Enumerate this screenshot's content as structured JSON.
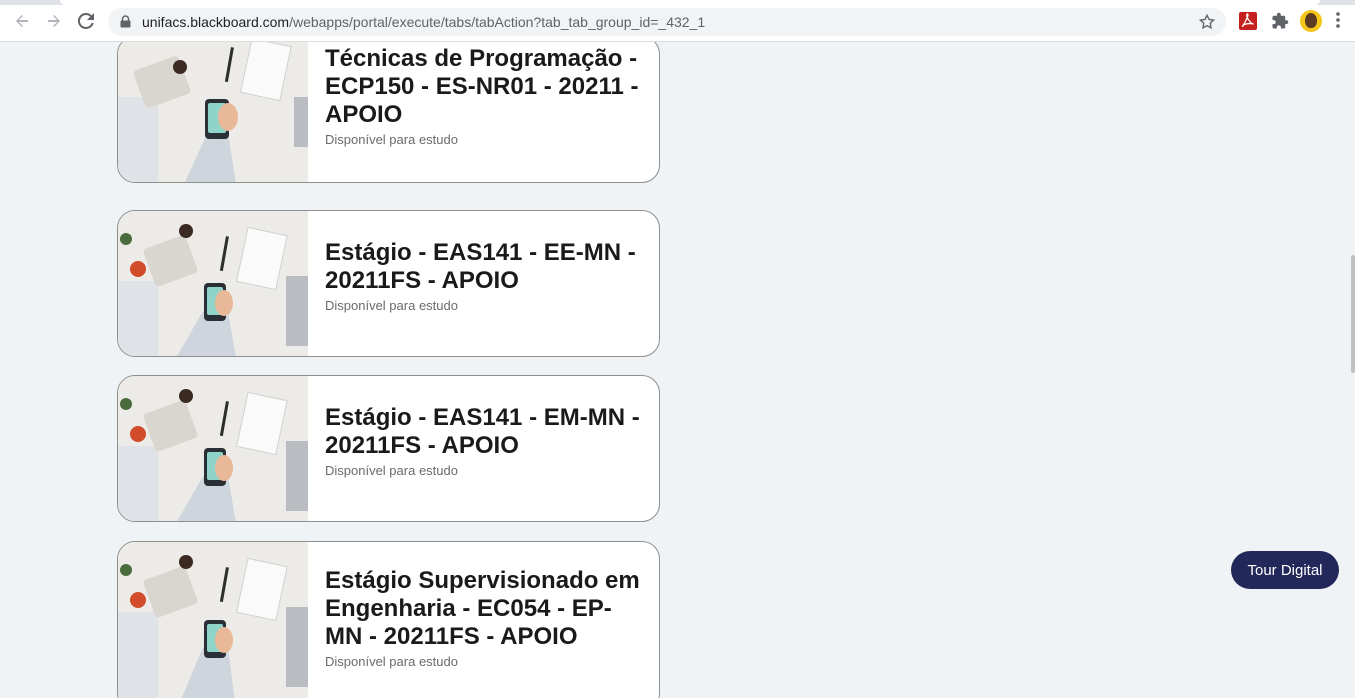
{
  "browser": {
    "url_host": "unifacs.blackboard.com",
    "url_path": "/webapps/portal/execute/tabs/tabAction?tab_tab_group_id=_432_1"
  },
  "courses": [
    {
      "title": "Técnicas de Programação - ECP150 - ES-NR01 - 20211 - APOIO",
      "status": "Disponível para estudo"
    },
    {
      "title": "Estágio - EAS141 - EE-MN - 20211FS - APOIO",
      "status": "Disponível para estudo"
    },
    {
      "title": "Estágio - EAS141 - EM-MN - 20211FS - APOIO",
      "status": "Disponível para estudo"
    },
    {
      "title": "Estágio Supervisionado em Engenharia - EC054 - EP-MN - 20211FS - APOIO",
      "status": "Disponível para estudo"
    }
  ],
  "tour_button": {
    "label": "Tour Digital"
  },
  "icons": [
    "back-icon",
    "forward-icon",
    "reload-icon",
    "lock-icon",
    "star-icon",
    "pdf-extension-icon",
    "puzzle-icon",
    "avatar",
    "menu-icon"
  ],
  "colors": {
    "page_bg": "#eff3f6",
    "tour_button_bg": "#23285a",
    "card_border": "#8e8e8e"
  }
}
